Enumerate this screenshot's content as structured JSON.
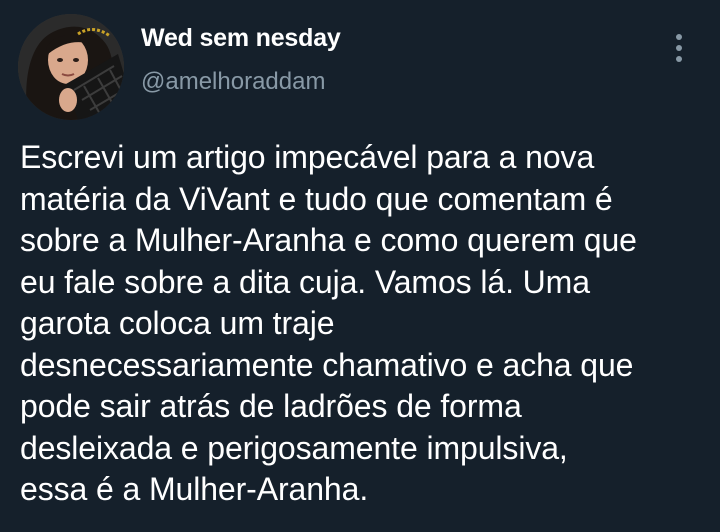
{
  "tweet": {
    "display_name": "Wed sem nesday",
    "handle": "@amelhoraddam",
    "text": "Escrevi um artigo impecável para a nova\nmatéria da ViVant e tudo que comentam é\nsobre a Mulher-Aranha e como querem que\neu fale sobre a dita cuja. Vamos lá. Uma\ngarota coloca um traje\ndesnecessariamente chamativo e acha que\npode sair atrás de ladrões de forma\ndesleixada e perigosamente impulsiva,\nessa é a Mulher-Aranha.",
    "more_icon": "vertical-ellipsis-icon"
  },
  "colors": {
    "background": "#15202b",
    "text_primary": "#ffffff",
    "text_secondary": "#8899a6"
  }
}
